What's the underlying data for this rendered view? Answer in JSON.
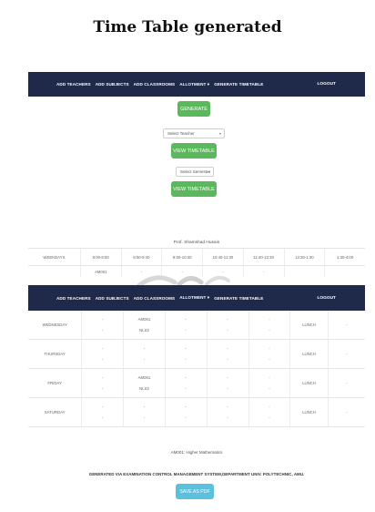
{
  "document": {
    "title": "Time Table generated"
  },
  "nav": {
    "items": [
      "ADD TEACHERS",
      "ADD SUBJECTS",
      "ADD CLASSROOMS",
      "ALLOTMENT ▾",
      "GENERATE TIMETABLE"
    ],
    "logout": "LOGOUT"
  },
  "controls": {
    "generate_label": "GENERATE",
    "teacher_select_value": "Select Teacher",
    "view_timetable_label": "VIEW TIMETABLE",
    "semester_select_value": "Select Semester",
    "view_timetable_label_2": "VIEW TIMETABLE"
  },
  "timetable": {
    "teacher_name": "Prof. Shamshad Husain",
    "columns": [
      "WEEKDAYS",
      "8:00-8:50",
      "8:50-9:40",
      "9:50-10:40",
      "10:40-11:30",
      "11:40-12:30",
      "12:30-1:30",
      "1:30-4:00"
    ],
    "partial_row": [
      "",
      "AM001",
      "-",
      "-",
      "-",
      "-",
      "",
      ""
    ],
    "rows": [
      {
        "day": "WEDNESDAY",
        "p1": [
          "-",
          "-"
        ],
        "p2": [
          "AM001",
          "NLS2"
        ],
        "p3": [
          "-",
          "-"
        ],
        "p4": [
          "-",
          "-"
        ],
        "p5": [
          "-",
          "-"
        ],
        "lunch": "LUNCH",
        "p6": "-"
      },
      {
        "day": "THURSDAY",
        "p1": [
          "-",
          "-"
        ],
        "p2": [
          "-",
          "-"
        ],
        "p3": [
          "-",
          "-"
        ],
        "p4": [
          "-",
          "-"
        ],
        "p5": [
          "-",
          "-"
        ],
        "lunch": "LUNCH",
        "p6": "-"
      },
      {
        "day": "FRIDAY",
        "p1": [
          "-",
          "-"
        ],
        "p2": [
          "AM001",
          "NLS2"
        ],
        "p3": [
          "-",
          "-"
        ],
        "p4": [
          "-",
          "-"
        ],
        "p5": [
          "-",
          "-"
        ],
        "lunch": "LUNCH",
        "p6": "-"
      },
      {
        "day": "SATURDAY",
        "p1": [
          "-",
          "-"
        ],
        "p2": [
          "-",
          "-"
        ],
        "p3": [
          "-",
          "-"
        ],
        "p4": [
          "-",
          "-"
        ],
        "p5": [
          "-",
          "-"
        ],
        "lunch": "LUNCH",
        "p6": "-"
      }
    ]
  },
  "footer": {
    "subject_line": "AM001: Higher Mathematics",
    "generated_by": "GENERATED VIA EXAMINATION CONTROL MANAGEMENT SYSTEM,DEPARTMENT UNIV. POLYTECHNIC, AMU.",
    "save_pdf_label": "SAVE AS PDF"
  },
  "colors": {
    "navbar": "#1f2a4a",
    "green_button": "#5cb85c",
    "pdf_button": "#5bc0de"
  }
}
